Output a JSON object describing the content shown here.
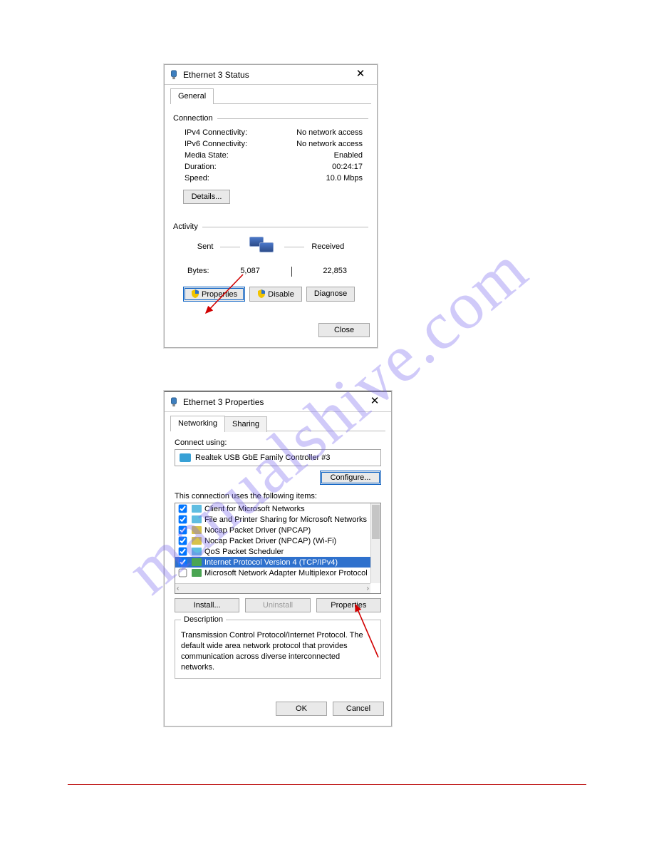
{
  "watermark": "manualshive.com",
  "status_dialog": {
    "title": "Ethernet 3 Status",
    "tab_general": "General",
    "group_connection": "Connection",
    "rows": {
      "ipv4_label": "IPv4 Connectivity:",
      "ipv4_value": "No network access",
      "ipv6_label": "IPv6 Connectivity:",
      "ipv6_value": "No network access",
      "media_label": "Media State:",
      "media_value": "Enabled",
      "dur_label": "Duration:",
      "dur_value": "00:24:17",
      "spd_label": "Speed:",
      "spd_value": "10.0 Mbps"
    },
    "details_btn": "Details...",
    "group_activity": "Activity",
    "sent_label": "Sent",
    "recv_label": "Received",
    "bytes_label": "Bytes:",
    "bytes_sent": "5,087",
    "bytes_recv": "22,853",
    "properties_btn": "Properties",
    "disable_btn": "Disable",
    "diagnose_btn": "Diagnose",
    "close_btn": "Close"
  },
  "props_dialog": {
    "title": "Ethernet 3 Properties",
    "tab_networking": "Networking",
    "tab_sharing": "Sharing",
    "connect_using_label": "Connect using:",
    "adapter_name": "Realtek USB GbE Family Controller #3",
    "configure_btn": "Configure...",
    "items_label": "This connection uses the following items:",
    "items": [
      {
        "checked": true,
        "icon": "blue",
        "label": "Client for Microsoft Networks"
      },
      {
        "checked": true,
        "icon": "blue",
        "label": "File and Printer Sharing for Microsoft Networks"
      },
      {
        "checked": true,
        "icon": "yellow",
        "label": "Nocap Packet Driver (NPCAP)"
      },
      {
        "checked": true,
        "icon": "yellow",
        "label": "Nocap Packet Driver (NPCAP) (Wi-Fi)"
      },
      {
        "checked": true,
        "icon": "blue",
        "label": "QoS Packet Scheduler"
      },
      {
        "checked": true,
        "icon": "green",
        "label": "Internet Protocol Version 4 (TCP/IPv4)",
        "selected": true
      },
      {
        "checked": false,
        "icon": "green",
        "label": "Microsoft Network Adapter Multiplexor Protocol"
      }
    ],
    "install_btn": "Install...",
    "uninstall_btn": "Uninstall",
    "properties_btn": "Properties",
    "desc_legend": "Description",
    "desc_text": "Transmission Control Protocol/Internet Protocol. The default wide area network protocol that provides communication across diverse interconnected networks.",
    "ok_btn": "OK",
    "cancel_btn": "Cancel"
  }
}
